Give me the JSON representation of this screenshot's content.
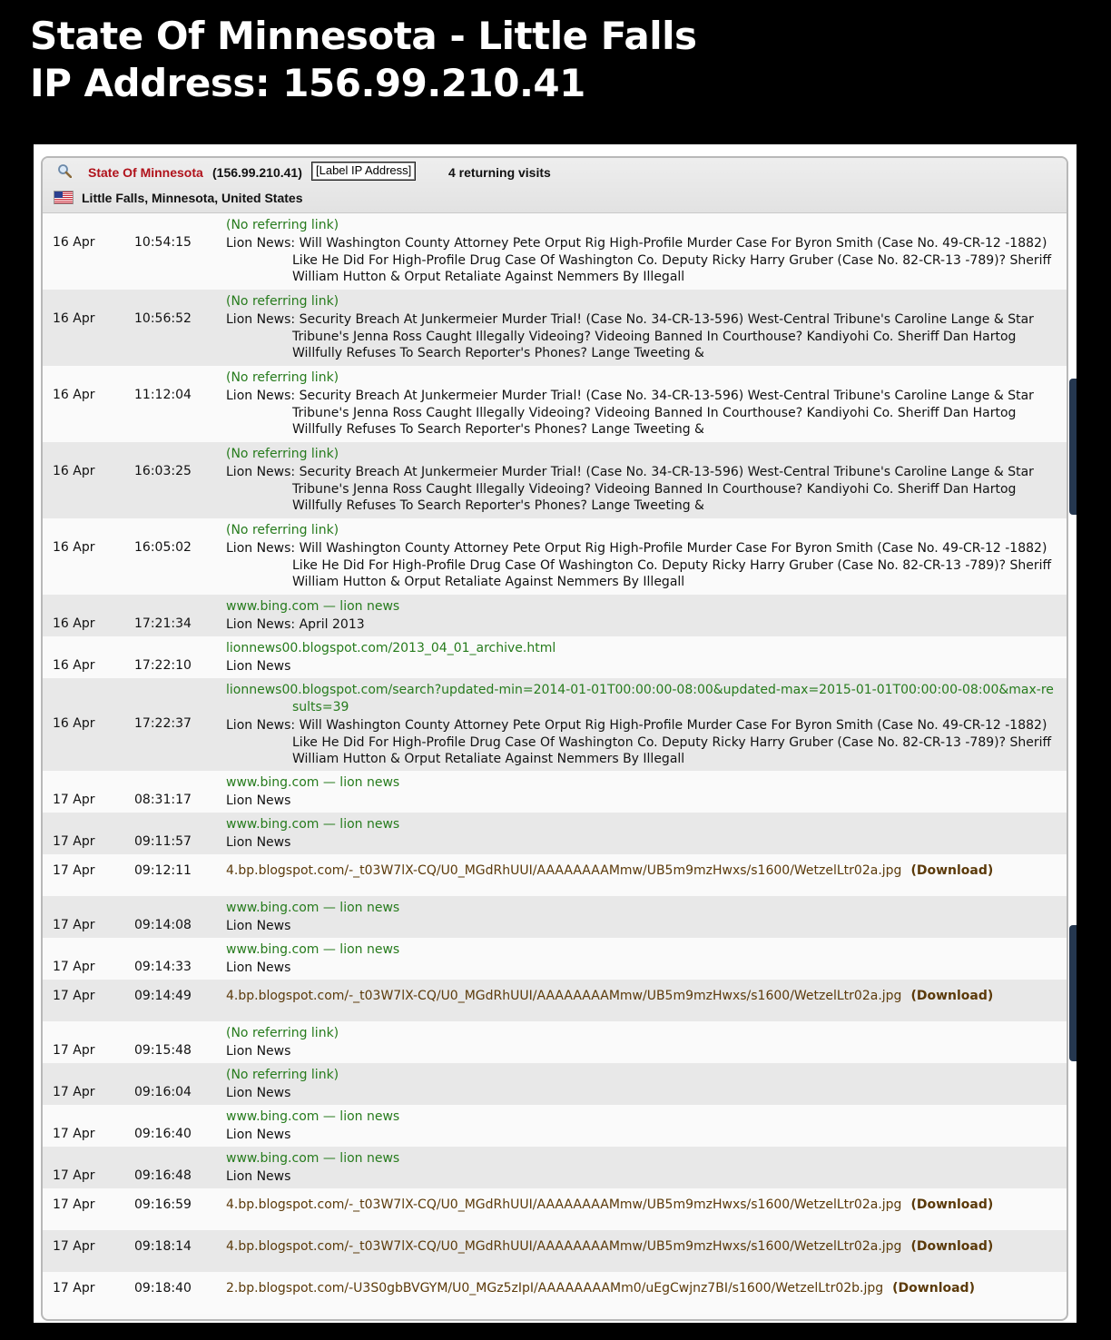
{
  "page_title": {
    "line1": "State Of Minnesota - Little Falls",
    "line2": "IP Address: 156.99.210.41"
  },
  "header": {
    "org_name": "State Of Minnesota",
    "ip": "(156.99.210.41)",
    "label_button": "[Label IP Address]",
    "visits": "4 returning visits",
    "location": "Little Falls, Minnesota, United States",
    "flag": "us-flag-icon"
  },
  "rows": [
    {
      "date": "16 Apr",
      "time": "10:54:15",
      "type": "page",
      "ref": "(No referring link)",
      "page": "Lion News: Will Washington County Attorney Pete Orput Rig High-Profile Murder Case For Byron Smith (Case No. 49-CR-12 -1882) Like He Did For High-Profile Drug Case Of Washington Co. Deputy Ricky Harry Gruber (Case No. 82-CR-13 -789)? Sheriff William Hutton & Orput Retaliate Against Nemmers By Illegall"
    },
    {
      "date": "16 Apr",
      "time": "10:56:52",
      "type": "page",
      "ref": "(No referring link)",
      "page": "Lion News: Security Breach At Junkermeier Murder Trial! (Case No. 34-CR-13-596) West-Central Tribune's Caroline Lange & Star Tribune's Jenna Ross Caught Illegally Videoing? Videoing Banned In Courthouse? Kandiyohi Co. Sheriff Dan Hartog Willfully Refuses To Search Reporter's Phones? Lange Tweeting &"
    },
    {
      "date": "16 Apr",
      "time": "11:12:04",
      "type": "page",
      "ref": "(No referring link)",
      "page": "Lion News: Security Breach At Junkermeier Murder Trial! (Case No. 34-CR-13-596) West-Central Tribune's Caroline Lange & Star Tribune's Jenna Ross Caught Illegally Videoing? Videoing Banned In Courthouse? Kandiyohi Co. Sheriff Dan Hartog Willfully Refuses To Search Reporter's Phones? Lange Tweeting &"
    },
    {
      "date": "16 Apr",
      "time": "16:03:25",
      "type": "page",
      "ref": "(No referring link)",
      "page": "Lion News: Security Breach At Junkermeier Murder Trial! (Case No. 34-CR-13-596) West-Central Tribune's Caroline Lange & Star Tribune's Jenna Ross Caught Illegally Videoing? Videoing Banned In Courthouse? Kandiyohi Co. Sheriff Dan Hartog Willfully Refuses To Search Reporter's Phones? Lange Tweeting &"
    },
    {
      "date": "16 Apr",
      "time": "16:05:02",
      "type": "page",
      "ref": "(No referring link)",
      "page": "Lion News: Will Washington County Attorney Pete Orput Rig High-Profile Murder Case For Byron Smith (Case No. 49-CR-12 -1882) Like He Did For High-Profile Drug Case Of Washington Co. Deputy Ricky Harry Gruber (Case No. 82-CR-13 -789)? Sheriff William Hutton & Orput Retaliate Against Nemmers By Illegall"
    },
    {
      "date": "16 Apr",
      "time": "17:21:34",
      "type": "page",
      "ref": "www.bing.com — lion news",
      "page": "Lion News: April 2013"
    },
    {
      "date": "16 Apr",
      "time": "17:22:10",
      "type": "page",
      "ref": "lionnews00.blogspot.com/2013_04_01_archive.html",
      "page": "Lion News"
    },
    {
      "date": "16 Apr",
      "time": "17:22:37",
      "type": "page",
      "ref": "lionnews00.blogspot.com/search?updated-min=2014-01-01T00:00:00-08:00&updated-max=2015-01-01T00:00:00-08:00&max-results=39",
      "page": "Lion News: Will Washington County Attorney Pete Orput Rig High-Profile Murder Case For Byron Smith (Case No. 49-CR-12 -1882) Like He Did For High-Profile Drug Case Of Washington Co. Deputy Ricky Harry Gruber (Case No. 82-CR-13 -789)? Sheriff William Hutton & Orput Retaliate Against Nemmers By Illegall"
    },
    {
      "date": "17 Apr",
      "time": "08:31:17",
      "type": "page",
      "ref": "www.bing.com — lion news",
      "page": "Lion News"
    },
    {
      "date": "17 Apr",
      "time": "09:11:57",
      "type": "page",
      "ref": "www.bing.com — lion news",
      "page": "Lion News"
    },
    {
      "date": "17 Apr",
      "time": "09:12:11",
      "type": "file",
      "file": "4.bp.blogspot.com/-_t03W7lX-CQ/U0_MGdRhUUI/AAAAAAAAMmw/UB5m9mzHwxs/s1600/WetzelLtr02a.jpg",
      "download": "(Download)"
    },
    {
      "date": "17 Apr",
      "time": "09:14:08",
      "type": "page",
      "ref": "www.bing.com — lion news",
      "page": "Lion News"
    },
    {
      "date": "17 Apr",
      "time": "09:14:33",
      "type": "page",
      "ref": "www.bing.com — lion news",
      "page": "Lion News"
    },
    {
      "date": "17 Apr",
      "time": "09:14:49",
      "type": "file",
      "file": "4.bp.blogspot.com/-_t03W7lX-CQ/U0_MGdRhUUI/AAAAAAAAMmw/UB5m9mzHwxs/s1600/WetzelLtr02a.jpg",
      "download": "(Download)"
    },
    {
      "date": "17 Apr",
      "time": "09:15:48",
      "type": "page",
      "ref": "(No referring link)",
      "page": "Lion News"
    },
    {
      "date": "17 Apr",
      "time": "09:16:04",
      "type": "page",
      "ref": "(No referring link)",
      "page": "Lion News"
    },
    {
      "date": "17 Apr",
      "time": "09:16:40",
      "type": "page",
      "ref": "www.bing.com — lion news",
      "page": "Lion News"
    },
    {
      "date": "17 Apr",
      "time": "09:16:48",
      "type": "page",
      "ref": "www.bing.com — lion news",
      "page": "Lion News"
    },
    {
      "date": "17 Apr",
      "time": "09:16:59",
      "type": "file",
      "file": "4.bp.blogspot.com/-_t03W7lX-CQ/U0_MGdRhUUI/AAAAAAAAMmw/UB5m9mzHwxs/s1600/WetzelLtr02a.jpg",
      "download": "(Download)"
    },
    {
      "date": "17 Apr",
      "time": "09:18:14",
      "type": "file",
      "file": "4.bp.blogspot.com/-_t03W7lX-CQ/U0_MGdRhUUI/AAAAAAAAMmw/UB5m9mzHwxs/s1600/WetzelLtr02a.jpg",
      "download": "(Download)"
    },
    {
      "date": "17 Apr",
      "time": "09:18:40",
      "type": "file",
      "file": "2.bp.blogspot.com/-U3S0gbBVGYM/U0_MGz5zIpI/AAAAAAAAMm0/uEgCwjnz7BI/s1600/WetzelLtr02b.jpg",
      "download": "(Download)"
    }
  ]
}
